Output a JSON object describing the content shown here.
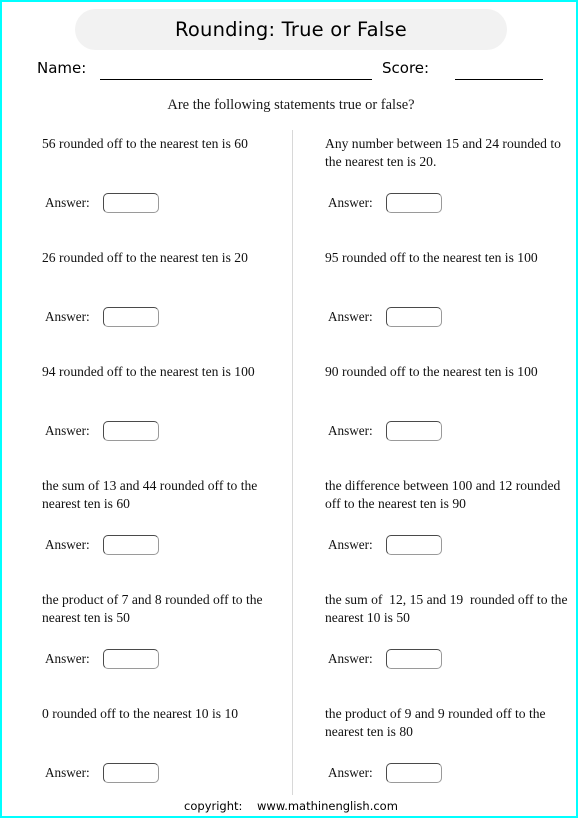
{
  "header": {
    "title": "Rounding: True or False",
    "name_label": "Name:",
    "score_label": "Score:",
    "instruction": "Are the following statements true or false?"
  },
  "answer_label": "Answer:",
  "columns": {
    "left": [
      {
        "text": "56 rounded off to the nearest ten is 60"
      },
      {
        "text": "26 rounded off to the nearest ten is 20"
      },
      {
        "text": "94 rounded off to the nearest ten is 100"
      },
      {
        "text": "the sum of 13 and 44 rounded off to the nearest ten is 60"
      },
      {
        "text": "the product of 7 and 8 rounded off to the nearest ten is 50"
      },
      {
        "text": "0 rounded off to the nearest 10 is 10"
      }
    ],
    "right": [
      {
        "text": "Any number between 15 and 24 rounded to the nearest ten is 20."
      },
      {
        "text": "95 rounded off to the nearest ten is 100"
      },
      {
        "text": "90 rounded off to the nearest ten is 100"
      },
      {
        "text": "the difference between 100 and 12 rounded off to the nearest ten is 90"
      },
      {
        "text": "the sum of  12, 15 and 19  rounded off to the nearest 10 is 50"
      },
      {
        "text": "the product of 9 and 9 rounded off to the nearest ten is 80"
      }
    ]
  },
  "footer": {
    "text": "copyright:    www.mathinenglish.com"
  },
  "colors": {
    "page_border": "#00ffff",
    "title_bar_bg": "#f2f2f2",
    "divider": "#d8d8d8",
    "text": "#111111"
  }
}
